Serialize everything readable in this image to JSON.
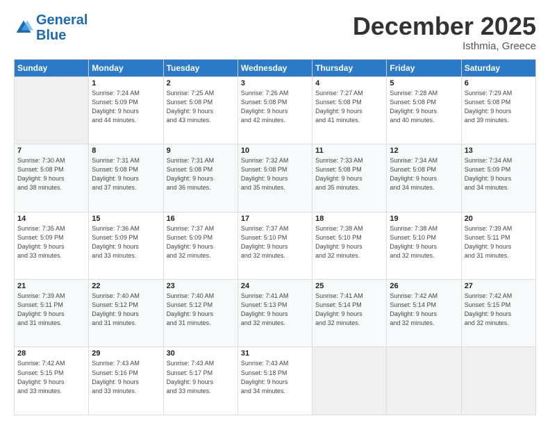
{
  "logo": {
    "line1": "General",
    "line2": "Blue"
  },
  "title": "December 2025",
  "subtitle": "Isthmia, Greece",
  "weekdays": [
    "Sunday",
    "Monday",
    "Tuesday",
    "Wednesday",
    "Thursday",
    "Friday",
    "Saturday"
  ],
  "weeks": [
    [
      {
        "day": "",
        "info": ""
      },
      {
        "day": "1",
        "info": "Sunrise: 7:24 AM\nSunset: 5:09 PM\nDaylight: 9 hours\nand 44 minutes."
      },
      {
        "day": "2",
        "info": "Sunrise: 7:25 AM\nSunset: 5:08 PM\nDaylight: 9 hours\nand 43 minutes."
      },
      {
        "day": "3",
        "info": "Sunrise: 7:26 AM\nSunset: 5:08 PM\nDaylight: 9 hours\nand 42 minutes."
      },
      {
        "day": "4",
        "info": "Sunrise: 7:27 AM\nSunset: 5:08 PM\nDaylight: 9 hours\nand 41 minutes."
      },
      {
        "day": "5",
        "info": "Sunrise: 7:28 AM\nSunset: 5:08 PM\nDaylight: 9 hours\nand 40 minutes."
      },
      {
        "day": "6",
        "info": "Sunrise: 7:29 AM\nSunset: 5:08 PM\nDaylight: 9 hours\nand 39 minutes."
      }
    ],
    [
      {
        "day": "7",
        "info": "Sunrise: 7:30 AM\nSunset: 5:08 PM\nDaylight: 9 hours\nand 38 minutes."
      },
      {
        "day": "8",
        "info": "Sunrise: 7:31 AM\nSunset: 5:08 PM\nDaylight: 9 hours\nand 37 minutes."
      },
      {
        "day": "9",
        "info": "Sunrise: 7:31 AM\nSunset: 5:08 PM\nDaylight: 9 hours\nand 36 minutes."
      },
      {
        "day": "10",
        "info": "Sunrise: 7:32 AM\nSunset: 5:08 PM\nDaylight: 9 hours\nand 35 minutes."
      },
      {
        "day": "11",
        "info": "Sunrise: 7:33 AM\nSunset: 5:08 PM\nDaylight: 9 hours\nand 35 minutes."
      },
      {
        "day": "12",
        "info": "Sunrise: 7:34 AM\nSunset: 5:08 PM\nDaylight: 9 hours\nand 34 minutes."
      },
      {
        "day": "13",
        "info": "Sunrise: 7:34 AM\nSunset: 5:09 PM\nDaylight: 9 hours\nand 34 minutes."
      }
    ],
    [
      {
        "day": "14",
        "info": "Sunrise: 7:35 AM\nSunset: 5:09 PM\nDaylight: 9 hours\nand 33 minutes."
      },
      {
        "day": "15",
        "info": "Sunrise: 7:36 AM\nSunset: 5:09 PM\nDaylight: 9 hours\nand 33 minutes."
      },
      {
        "day": "16",
        "info": "Sunrise: 7:37 AM\nSunset: 5:09 PM\nDaylight: 9 hours\nand 32 minutes."
      },
      {
        "day": "17",
        "info": "Sunrise: 7:37 AM\nSunset: 5:10 PM\nDaylight: 9 hours\nand 32 minutes."
      },
      {
        "day": "18",
        "info": "Sunrise: 7:38 AM\nSunset: 5:10 PM\nDaylight: 9 hours\nand 32 minutes."
      },
      {
        "day": "19",
        "info": "Sunrise: 7:38 AM\nSunset: 5:10 PM\nDaylight: 9 hours\nand 32 minutes."
      },
      {
        "day": "20",
        "info": "Sunrise: 7:39 AM\nSunset: 5:11 PM\nDaylight: 9 hours\nand 31 minutes."
      }
    ],
    [
      {
        "day": "21",
        "info": "Sunrise: 7:39 AM\nSunset: 5:11 PM\nDaylight: 9 hours\nand 31 minutes."
      },
      {
        "day": "22",
        "info": "Sunrise: 7:40 AM\nSunset: 5:12 PM\nDaylight: 9 hours\nand 31 minutes."
      },
      {
        "day": "23",
        "info": "Sunrise: 7:40 AM\nSunset: 5:12 PM\nDaylight: 9 hours\nand 31 minutes."
      },
      {
        "day": "24",
        "info": "Sunrise: 7:41 AM\nSunset: 5:13 PM\nDaylight: 9 hours\nand 32 minutes."
      },
      {
        "day": "25",
        "info": "Sunrise: 7:41 AM\nSunset: 5:14 PM\nDaylight: 9 hours\nand 32 minutes."
      },
      {
        "day": "26",
        "info": "Sunrise: 7:42 AM\nSunset: 5:14 PM\nDaylight: 9 hours\nand 32 minutes."
      },
      {
        "day": "27",
        "info": "Sunrise: 7:42 AM\nSunset: 5:15 PM\nDaylight: 9 hours\nand 32 minutes."
      }
    ],
    [
      {
        "day": "28",
        "info": "Sunrise: 7:42 AM\nSunset: 5:15 PM\nDaylight: 9 hours\nand 33 minutes."
      },
      {
        "day": "29",
        "info": "Sunrise: 7:43 AM\nSunset: 5:16 PM\nDaylight: 9 hours\nand 33 minutes."
      },
      {
        "day": "30",
        "info": "Sunrise: 7:43 AM\nSunset: 5:17 PM\nDaylight: 9 hours\nand 33 minutes."
      },
      {
        "day": "31",
        "info": "Sunrise: 7:43 AM\nSunset: 5:18 PM\nDaylight: 9 hours\nand 34 minutes."
      },
      {
        "day": "",
        "info": ""
      },
      {
        "day": "",
        "info": ""
      },
      {
        "day": "",
        "info": ""
      }
    ]
  ]
}
